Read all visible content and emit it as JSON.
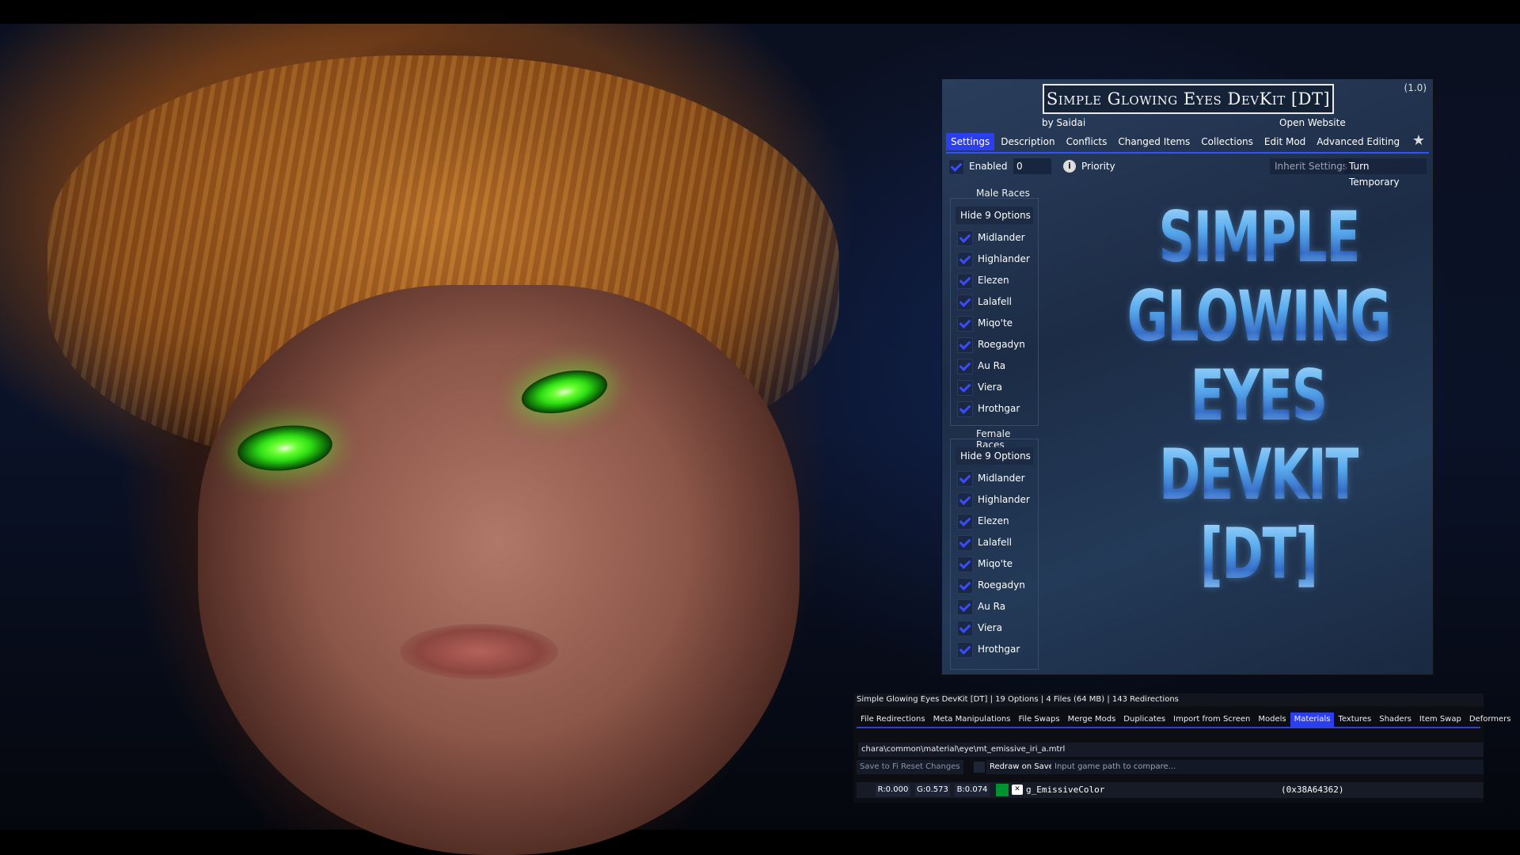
{
  "window": {
    "title": "Simple Glowing Eyes DevKit [DT]",
    "version": "(1.0)",
    "author_prefix": "by",
    "author": "Saidai",
    "open_website": "Open Website"
  },
  "tabs": [
    {
      "label": "Settings",
      "active": true
    },
    {
      "label": "Description"
    },
    {
      "label": "Conflicts"
    },
    {
      "label": "Changed Items"
    },
    {
      "label": "Collections"
    },
    {
      "label": "Edit Mod"
    },
    {
      "label": "Advanced Editing"
    }
  ],
  "settings": {
    "enabled_label": "Enabled",
    "priority_value": "0",
    "priority_label": "Priority",
    "inherit_settings": "Inherit Settings",
    "turn_temporary": "Turn Temporary"
  },
  "groups": {
    "male": {
      "title": "Male Races",
      "hide_label": "Hide 9 Options",
      "options": [
        "Midlander",
        "Highlander",
        "Elezen",
        "Lalafell",
        "Miqo'te",
        "Roegadyn",
        "Au Ra",
        "Viera",
        "Hrothgar"
      ]
    },
    "female": {
      "title": "Female Races",
      "hide_label": "Hide 9 Options",
      "options": [
        "Midlander",
        "Highlander",
        "Elezen",
        "Lalafell",
        "Miqo'te",
        "Roegadyn",
        "Au Ra",
        "Viera",
        "Hrothgar"
      ]
    }
  },
  "art_text": [
    "SIMPLE",
    "GLOWING",
    "EYES",
    "DEVKIT",
    "[DT]"
  ],
  "editor": {
    "status": "Simple Glowing Eyes DevKit [DT]  |  19 Options  |  4 Files (64 MB)  |  143 Redirections",
    "tabs": [
      {
        "label": "File Redirections"
      },
      {
        "label": "Meta Manipulations"
      },
      {
        "label": "File Swaps"
      },
      {
        "label": "Merge Mods"
      },
      {
        "label": "Duplicates"
      },
      {
        "label": "Import from Screen"
      },
      {
        "label": "Models"
      },
      {
        "label": "Materials",
        "active": true
      },
      {
        "label": "Textures"
      },
      {
        "label": "Shaders"
      },
      {
        "label": "Item Swap"
      },
      {
        "label": "Deformers"
      }
    ],
    "path": "chara\\common\\material\\eye\\mt_emissive_iri_a.mtrl",
    "save_to_file": "Save to File",
    "reset_changes": "Reset Changes",
    "redraw_on_save": "Redraw on Save",
    "compare_placeholder": "Input game path to compare...",
    "color": {
      "r": "R:0.000",
      "g": "G:0.573",
      "b": "B:0.074",
      "swatch": "#00922f"
    },
    "param_name": "g_EmissiveColor",
    "param_id": "(0x38A64362)"
  },
  "colors": {
    "accent": "#2c3ff0",
    "check": "#3a4cff"
  }
}
